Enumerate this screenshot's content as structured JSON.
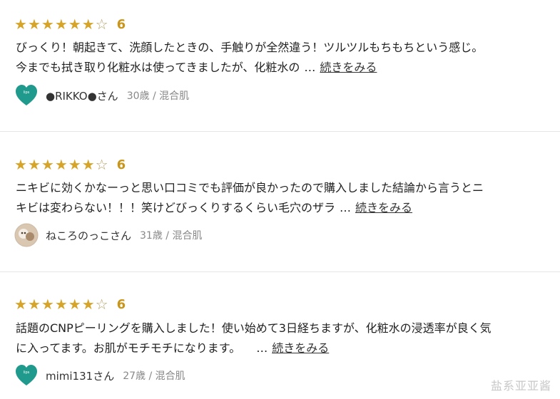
{
  "reviews": [
    {
      "score": "6",
      "line1": "びっくり！朝起きて、洗顔したときの、手触りが全然違う！ツルツルもちもちという感じ。",
      "line2": "今までも拭き取り化粧水は使ってきましたが、化粧水の",
      "ellipsis": "…",
      "more": "続きをみる",
      "name": "●RIKKO●さん",
      "meta": "30歳 / 混合肌",
      "avatar_icon": "brand-heart-icon"
    },
    {
      "score": "6",
      "line1": "ニキビに効くかなーっと思い口コミでも評価が良かったので購入しました結論から言うとニ",
      "line2": "キビは変わらない！！！笑けどびっくりするくらい毛穴のザラ",
      "ellipsis": "…",
      "more": "続きをみる",
      "name": "ねころのっこさん",
      "meta": "31歳 / 混合肌",
      "avatar_icon": "user-photo-avatar"
    },
    {
      "score": "6",
      "line1": "話題のCNPピーリングを購入しました！使い始めて3日経ちますが、化粧水の浸透率が良く気",
      "line2": "に入ってます。お肌がモチモチになります。",
      "ellipsis": "…",
      "more": "続きをみる",
      "name": "mimi131さん",
      "meta": "27歳 / 混合肌",
      "avatar_icon": "brand-heart-icon"
    }
  ],
  "stars": {
    "filled": 6,
    "total": 7,
    "full_char": "★",
    "empty_char": "☆",
    "color": "#d6a428"
  },
  "watermark": "盐系亚亚酱"
}
